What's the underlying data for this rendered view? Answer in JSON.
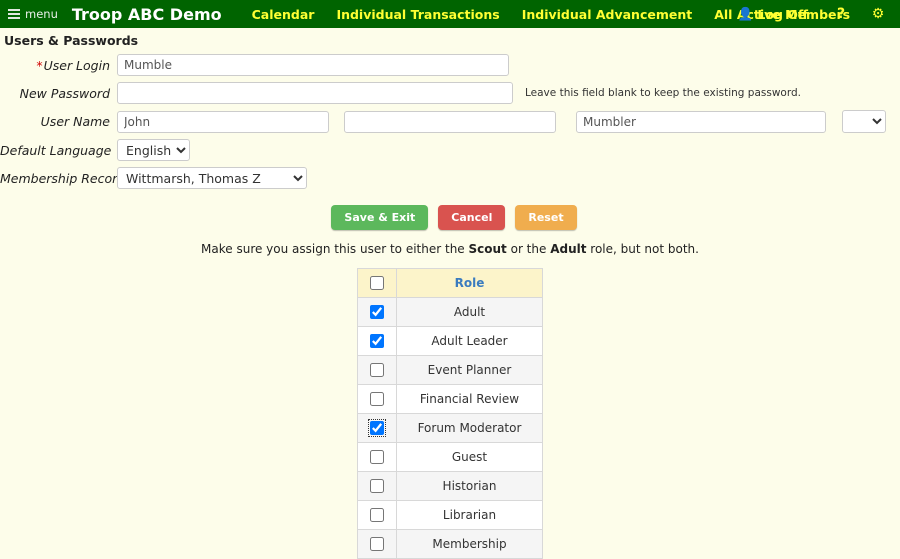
{
  "topbar": {
    "menu_label": "menu",
    "brand": "Troop ABC Demo",
    "nav": [
      {
        "label": "Calendar"
      },
      {
        "label": "Individual Transactions"
      },
      {
        "label": "Individual Advancement"
      },
      {
        "label": "All Active Members"
      }
    ],
    "logoff_label": "Log Off",
    "help_label": "?",
    "gear_label": "⚙",
    "bar_color": "#006400",
    "link_color": "#ffff33"
  },
  "page": {
    "title": "Users & Passwords",
    "background": "#fdfdea"
  },
  "form": {
    "user_login": {
      "label": "User Login",
      "required_marker": "*",
      "value": "Mumble",
      "placeholder": ""
    },
    "new_password": {
      "label": "New Password",
      "value": "",
      "placeholder": "",
      "hint": "Leave this field blank to keep the existing password."
    },
    "user_name": {
      "label": "User Name",
      "first_value": "John",
      "first_placeholder": "",
      "middle_value": "",
      "middle_placeholder": "",
      "last_value": "Mumbler",
      "last_placeholder": "",
      "suffix_selected": ""
    },
    "default_language": {
      "label": "Default Language",
      "selected": "English"
    },
    "membership_record": {
      "label": "Membership Record",
      "selected": "Wittmarsh, Thomas Z"
    }
  },
  "buttons": {
    "save": "Save & Exit",
    "cancel": "Cancel",
    "reset": "Reset",
    "save_color": "#5cb85c",
    "cancel_color": "#d9534f",
    "reset_color": "#f0ad4e"
  },
  "note": {
    "part1": "Make sure you assign this user to either the ",
    "bold1": "Scout",
    "part2": " or the ",
    "bold2": "Adult",
    "part3": " role, but not both."
  },
  "roles_table": {
    "header_checkbox_checked": false,
    "column_header": "Role",
    "rows": [
      {
        "role": "Adult",
        "checked": true,
        "focused": false
      },
      {
        "role": "Adult Leader",
        "checked": true,
        "focused": false
      },
      {
        "role": "Event Planner",
        "checked": false,
        "focused": false
      },
      {
        "role": "Financial Review",
        "checked": false,
        "focused": false
      },
      {
        "role": "Forum Moderator",
        "checked": true,
        "focused": true
      },
      {
        "role": "Guest",
        "checked": false,
        "focused": false
      },
      {
        "role": "Historian",
        "checked": false,
        "focused": false
      },
      {
        "role": "Librarian",
        "checked": false,
        "focused": false
      },
      {
        "role": "Membership",
        "checked": false,
        "focused": false
      }
    ]
  }
}
